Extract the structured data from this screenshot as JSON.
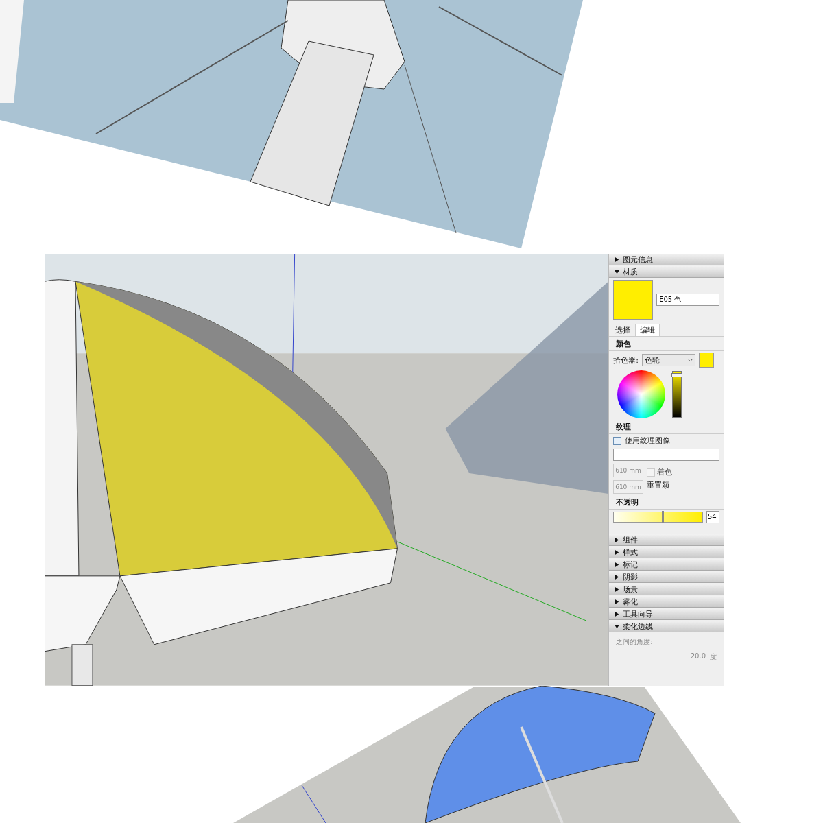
{
  "top_accordion": [
    {
      "label": "图元信息",
      "expanded": false
    },
    {
      "label": "材质",
      "expanded": true
    }
  ],
  "material": {
    "name": "E05 色",
    "color": "#ffee00"
  },
  "tabs": [
    {
      "label": "选择",
      "selected": false
    },
    {
      "label": "编辑",
      "selected": true
    }
  ],
  "color_section": {
    "title": "颜色",
    "picker_label": "拾色器:",
    "picker_value": "色轮",
    "color": "#ffee00",
    "brightness": {
      "level": 0.96
    }
  },
  "texture_section": {
    "title": "纹理",
    "use_texture": {
      "label": "使用纹理图像",
      "checked": false
    },
    "width": "610 mm",
    "height": "610 mm",
    "colorize": {
      "label": "着色",
      "checked": false
    },
    "reset_label": "重置颜"
  },
  "opacity_section": {
    "title": "不透明",
    "level": 0.54,
    "value": "54"
  },
  "bottom_accordion": [
    {
      "label": "组件",
      "expanded": false
    },
    {
      "label": "样式",
      "expanded": false
    },
    {
      "label": "标记",
      "expanded": false
    },
    {
      "label": "阴影",
      "expanded": false
    },
    {
      "label": "场景",
      "expanded": false
    },
    {
      "label": "雾化",
      "expanded": false
    },
    {
      "label": "工具向导",
      "expanded": false
    },
    {
      "label": "柔化边线",
      "expanded": true,
      "field_label": "之间的角度:",
      "field_value": "20.0",
      "unit": "度"
    }
  ]
}
